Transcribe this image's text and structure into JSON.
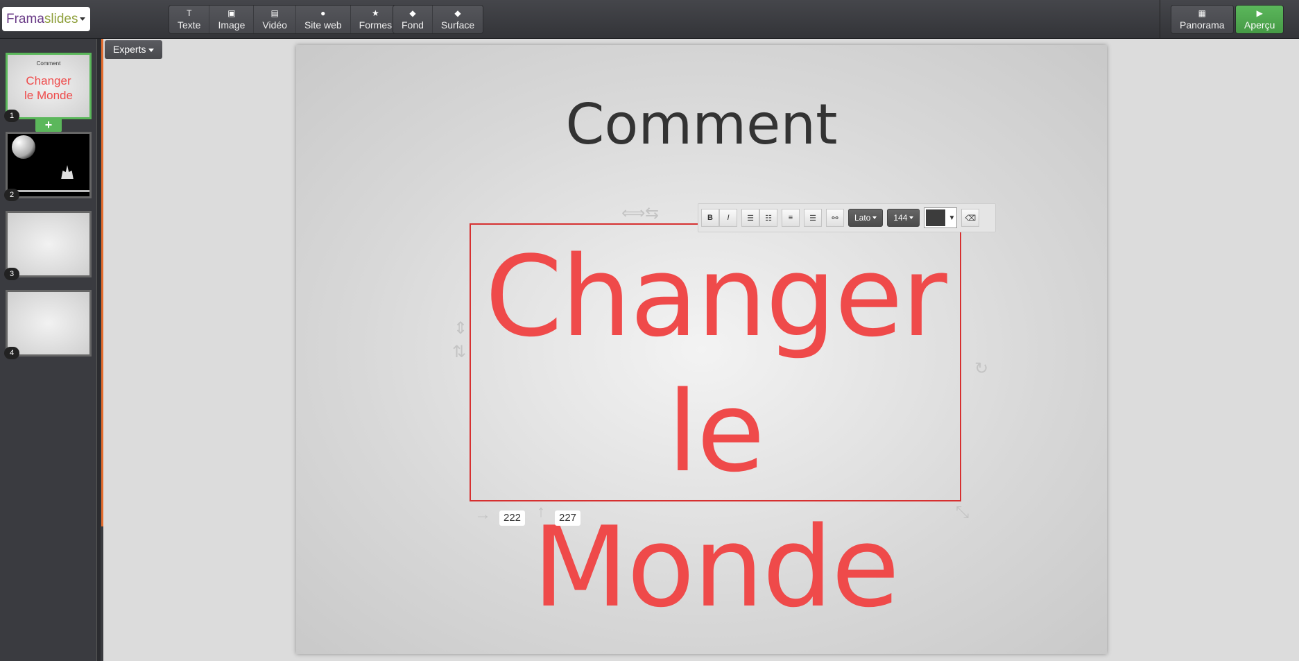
{
  "brand": {
    "part1": "Frama",
    "part2": "slides"
  },
  "toolbar": {
    "insert": [
      {
        "icon": "T",
        "label": "Texte"
      },
      {
        "icon": "▣",
        "label": "Image"
      },
      {
        "icon": "▤",
        "label": "Vidéo"
      },
      {
        "icon": "●",
        "label": "Site web"
      },
      {
        "icon": "★",
        "label": "Formes"
      }
    ],
    "style": [
      {
        "icon": "◆",
        "label": "Fond"
      },
      {
        "icon": "◆",
        "label": "Surface"
      }
    ],
    "panorama": {
      "icon": "▦",
      "label": "Panorama"
    },
    "apercu": {
      "icon": "▶",
      "label": "Aperçu"
    }
  },
  "experts_label": "Experts",
  "slides": [
    {
      "number": "1",
      "title": "Comment",
      "text1": "Changer",
      "text2": "le Monde"
    },
    {
      "number": "2"
    },
    {
      "number": "3"
    },
    {
      "number": "4"
    }
  ],
  "add_slide": "+",
  "slide": {
    "title": "Comment",
    "line1": "Changer",
    "line2": "le Monde"
  },
  "position": {
    "x": "222",
    "y": "227"
  },
  "text_toolbar": {
    "bold": "B",
    "italic": "I",
    "font": "Lato",
    "size": "144",
    "color": "#3c3c3c"
  }
}
